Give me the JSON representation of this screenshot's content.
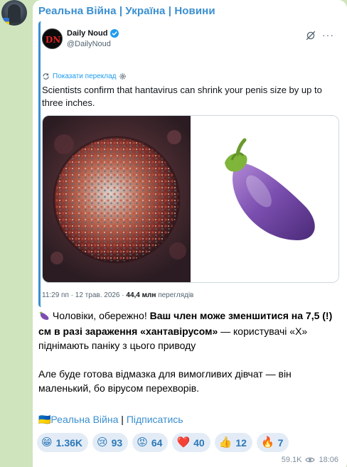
{
  "channel": {
    "title": "Реальна Війна | Україна | Новини"
  },
  "tweet": {
    "author_name": "Daily Noud",
    "author_handle": "@DailyNoud",
    "translate_label": "Показати переклад",
    "text": "Scientists confirm that hantavirus can shrink your penis size by up to three inches.",
    "time": "11:29 пп · 12 трав. 2026 · ",
    "views_count": "44,4 млн",
    "views_label": " переглядів"
  },
  "post": {
    "p1_plain1": " Чоловіки, обережно! ",
    "p1_bold": "Ваш член може зменшитися на 7,5 (!) см в разі зараження «хантавірусом»",
    "p1_plain2": " — користувачі «Х» піднімають паніку з цього приводу",
    "p2": "Але буде готова відмазка для вимогливих дівчат — він маленький, бо вірусом перехворів."
  },
  "footer": {
    "channel_link": "🇺🇦Реальна Війна",
    "separator": " | ",
    "subscribe_link": "Підписатись"
  },
  "reactions": [
    {
      "emoji": "😁",
      "count": "1.36K"
    },
    {
      "emoji": "😢",
      "count": "93"
    },
    {
      "emoji": "😡",
      "count": "64"
    },
    {
      "emoji": "❤️",
      "count": "40"
    },
    {
      "emoji": "👍",
      "count": "12"
    },
    {
      "emoji": "🔥",
      "count": "7"
    }
  ],
  "message_meta": {
    "views": "59.1K",
    "time": "18:06"
  },
  "icons": {
    "avatar": "channel-avatar",
    "verified": "verified-badge-icon",
    "grok": "grok-icon",
    "more": "more-options-icon",
    "translate": "translate-icon",
    "gear": "gear-icon",
    "eggplant": "eggplant-emoji",
    "eye": "eye-icon"
  },
  "colors": {
    "background": "#cfe3bd",
    "link": "#3a8fd0",
    "twitter_blue": "#1d9bf0",
    "reaction_bg": "#e3ecf6"
  }
}
